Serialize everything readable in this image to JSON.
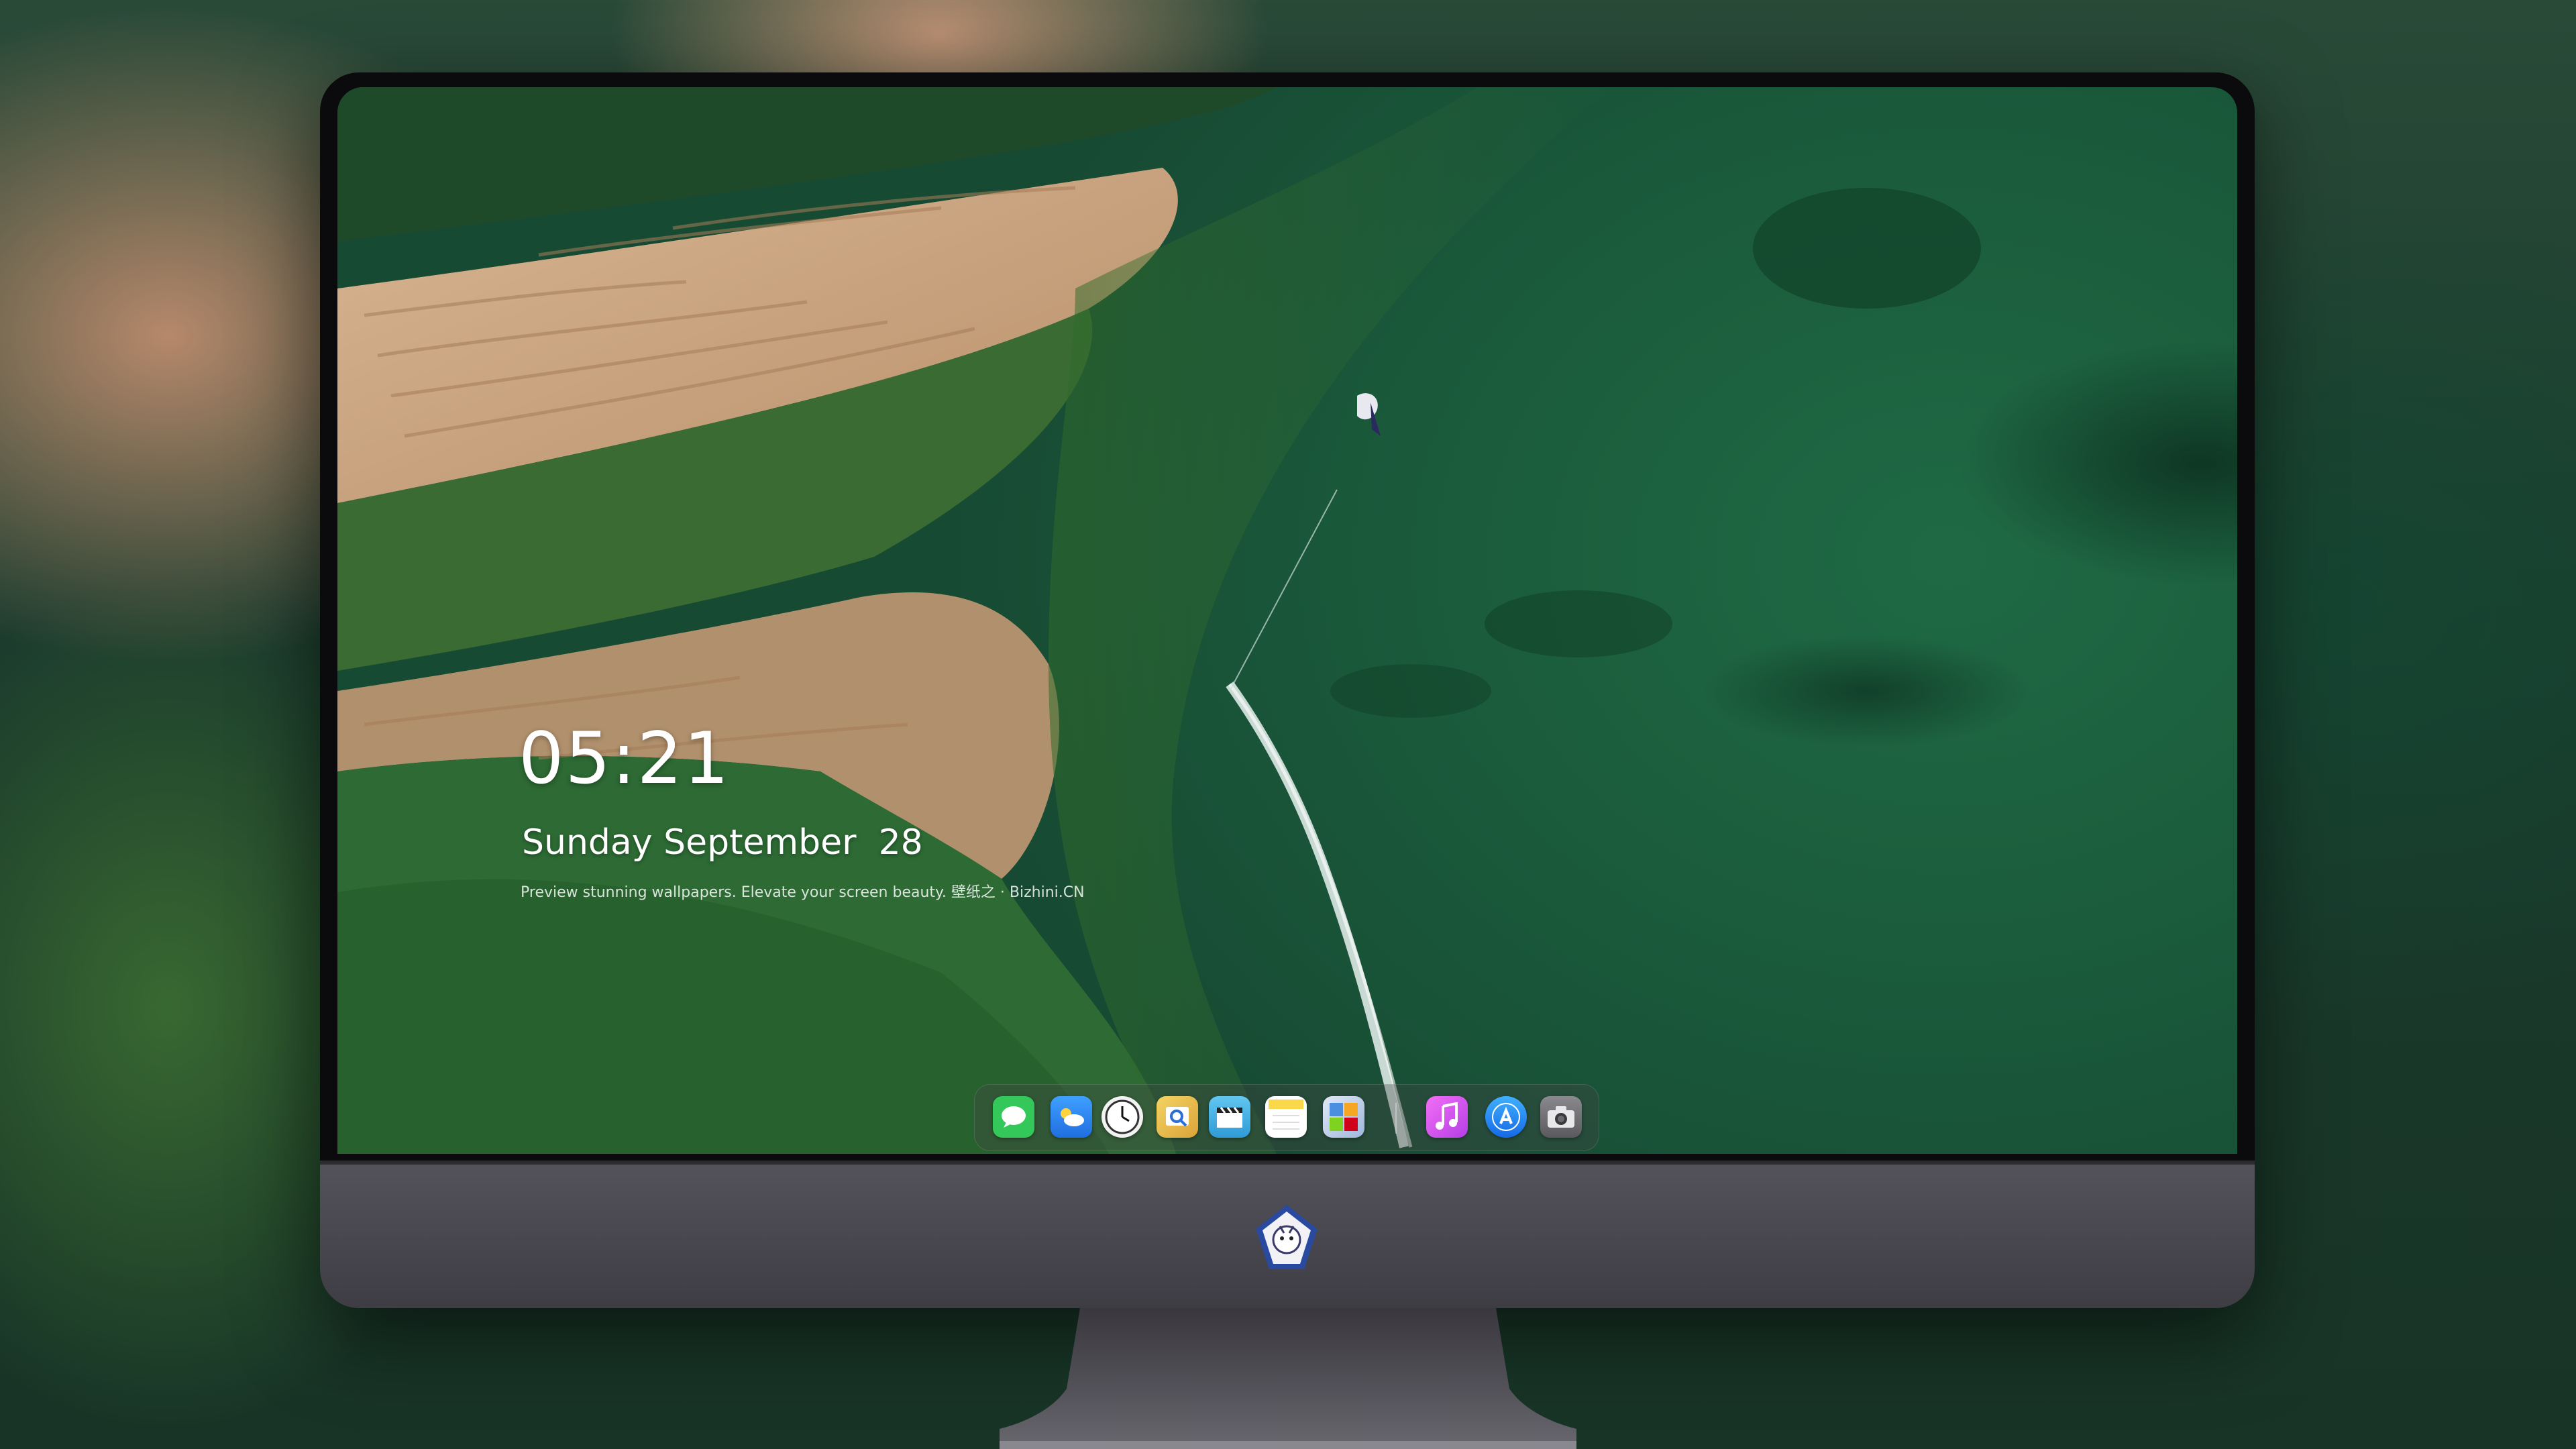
{
  "lockscreen": {
    "time": "05:21",
    "date": "Sunday September  28",
    "tagline": "Preview stunning wallpapers. Elevate your screen beauty. 壁纸之 · Bizhini.CN"
  },
  "dock": {
    "apps": [
      {
        "name": "Messages",
        "icon": "messages-icon",
        "color": "#34c759"
      },
      {
        "name": "Weather",
        "icon": "weather-icon",
        "color": "#2f8cf0"
      },
      {
        "name": "Clock",
        "icon": "clock-icon",
        "color": "#f2f2f2"
      },
      {
        "name": "Preview",
        "icon": "preview-icon",
        "color": "#e9c24a"
      },
      {
        "name": "Clips",
        "icon": "clapperboard-icon",
        "color": "#4fb3e8"
      },
      {
        "name": "Notes",
        "icon": "notes-icon",
        "color": "#fbd84a"
      },
      {
        "name": "Photo Booth",
        "icon": "photo-booth-icon",
        "color": "#4a8fe0"
      },
      {
        "name": "iTunes",
        "icon": "music-note-icon",
        "color": "#d95be8"
      },
      {
        "name": "App Store",
        "icon": "app-store-icon",
        "color": "#1e8cf5"
      },
      {
        "name": "Camera",
        "icon": "camera-icon",
        "color": "#6d6d70"
      }
    ]
  },
  "colors": {
    "water": "#1a5a3b",
    "sand": "#c9a27f",
    "monitor_chin": "#4a4850",
    "bezel": "#0b0b0d"
  }
}
